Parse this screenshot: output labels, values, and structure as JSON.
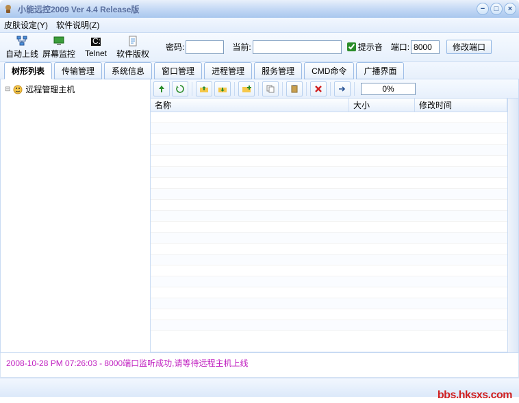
{
  "window": {
    "title": "小能远控2009  Ver 4.4 Release版"
  },
  "menu": {
    "skin": "皮肤设定(Y)",
    "about": "软件说明(Z)"
  },
  "toolbar": {
    "auto_online": "自动上线",
    "screen_monitor": "屏幕监控",
    "telnet": "Telnet",
    "copyright": "软件版权",
    "password_label": "密码:",
    "password_value": "",
    "current_label": "当前:",
    "current_value": "",
    "sound_check": "提示音",
    "port_label": "端口:",
    "port_value": "8000",
    "change_port": "修改端口"
  },
  "tabs": [
    "树形列表",
    "传输管理",
    "系统信息",
    "窗口管理",
    "进程管理",
    "服务管理",
    "CMD命令",
    "广播界面"
  ],
  "tree": {
    "root_label": "远程管理主机"
  },
  "filetoolbar": {
    "progress": "0%"
  },
  "list": {
    "columns": {
      "name": "名称",
      "size": "大小",
      "mtime": "修改时间"
    }
  },
  "status": "2008-10-28 PM 07:26:03 - 8000端口监听成功,请等待远程主机上线",
  "watermark": "bbs.hksxs.com"
}
